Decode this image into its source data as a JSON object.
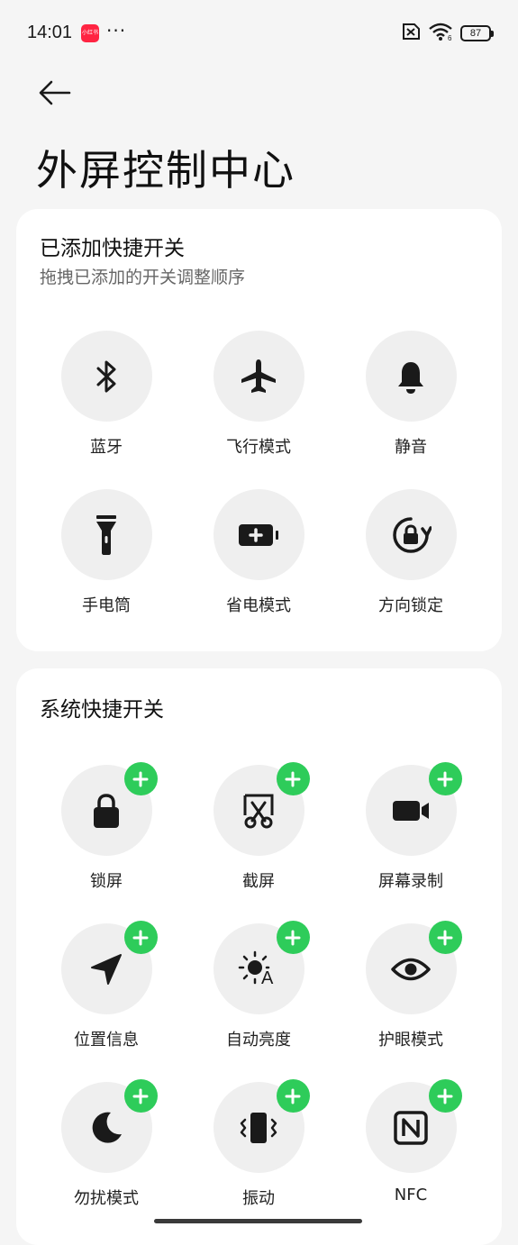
{
  "status_bar": {
    "time": "14:01",
    "app_badge_text": "小红书",
    "more": "···",
    "battery": "87"
  },
  "page": {
    "title": "外屏控制中心"
  },
  "added_section": {
    "title": "已添加快捷开关",
    "subtitle": "拖拽已添加的开关调整顺序",
    "tiles": [
      {
        "label": "蓝牙",
        "icon": "bluetooth-icon"
      },
      {
        "label": "飞行模式",
        "icon": "airplane-icon"
      },
      {
        "label": "静音",
        "icon": "bell-icon"
      },
      {
        "label": "手电筒",
        "icon": "flashlight-icon"
      },
      {
        "label": "省电模式",
        "icon": "battery-saver-icon"
      },
      {
        "label": "方向锁定",
        "icon": "rotation-lock-icon"
      }
    ]
  },
  "system_section": {
    "title": "系统快捷开关",
    "tiles": [
      {
        "label": "锁屏",
        "icon": "lock-icon"
      },
      {
        "label": "截屏",
        "icon": "screenshot-icon"
      },
      {
        "label": "屏幕录制",
        "icon": "screen-record-icon"
      },
      {
        "label": "位置信息",
        "icon": "location-icon"
      },
      {
        "label": "自动亮度",
        "icon": "auto-brightness-icon"
      },
      {
        "label": "护眼模式",
        "icon": "eye-icon"
      },
      {
        "label": "勿扰模式",
        "icon": "moon-icon"
      },
      {
        "label": "振动",
        "icon": "vibrate-icon"
      },
      {
        "label": "NFC",
        "icon": "nfc-icon"
      }
    ]
  },
  "colors": {
    "background": "#f5f5f5",
    "card": "#ffffff",
    "tile": "#efefef",
    "add_badge": "#2ecc5a",
    "icon": "#1a1a1a"
  }
}
